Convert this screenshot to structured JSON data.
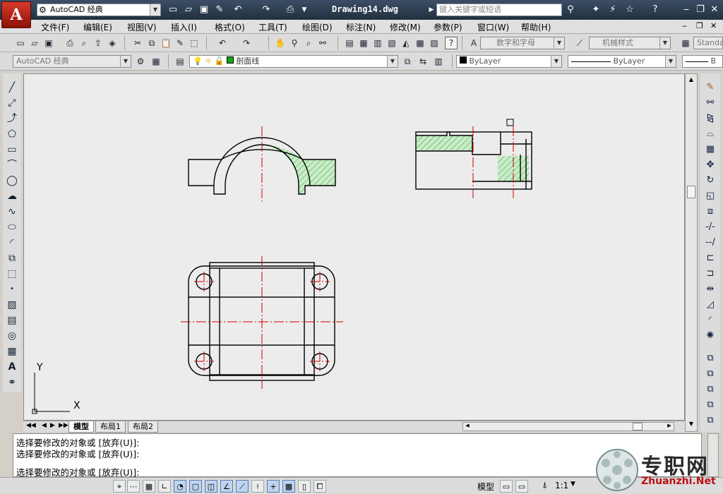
{
  "title_bar": {
    "logo_letter": "A",
    "workspace": "AutoCAD 经典",
    "document_title": "Drawing14.dwg",
    "search_placeholder": "键入关键字或短语"
  },
  "menu": [
    "文件(F)",
    "编辑(E)",
    "视图(V)",
    "插入(I)",
    "格式(O)",
    "工具(T)",
    "绘图(D)",
    "标注(N)",
    "修改(M)",
    "参数(P)",
    "窗口(W)",
    "帮助(H)"
  ],
  "toolbar_standard": {
    "text_style": "数字和字母",
    "dim_style": "机械样式",
    "table_style": "Standa"
  },
  "toolbar_layers": {
    "workspace": "AutoCAD 经典",
    "layer": "剖面线",
    "color": "ByLayer",
    "linetype": "ByLayer",
    "lineweight": "B"
  },
  "canvas": {
    "ucs_y": "Y",
    "ucs_x": "X",
    "colors": {
      "background": "#ececec",
      "outline": "#000000",
      "centerline": "#cc0000",
      "hatch": "#2a9a2a",
      "hatch_fill": "#c9ecc9"
    }
  },
  "layout_tabs": [
    "模型",
    "布局1",
    "布局2"
  ],
  "command_lines": [
    "选择要修改的对象或 [放弃(U)]:",
    "选择要修改的对象或 [放弃(U)]:",
    "选择要修改的对象或 [放弃(U)]:"
  ],
  "status_bar": {
    "model_label": "模型",
    "scale": "1:1"
  },
  "watermark": {
    "cn": "专职网",
    "url": "Zhuanzhi.Net"
  }
}
